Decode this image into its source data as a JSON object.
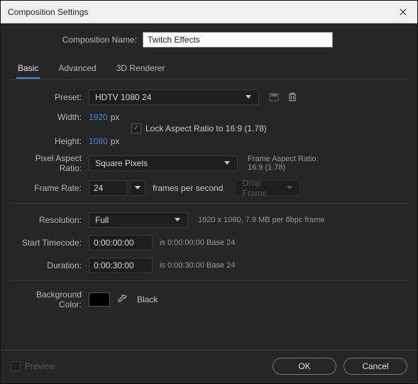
{
  "titlebar": {
    "title": "Composition Settings"
  },
  "comp_name": {
    "label": "Composition Name:",
    "value": "Twitch Effects"
  },
  "tabs": {
    "basic": "Basic",
    "advanced": "Advanced",
    "renderer": "3D Renderer"
  },
  "preset": {
    "label": "Preset:",
    "value": "HDTV 1080 24"
  },
  "width": {
    "label": "Width:",
    "value": "1920",
    "unit": "px"
  },
  "height": {
    "label": "Height:",
    "value": "1080",
    "unit": "px"
  },
  "lock_aspect": {
    "label": "Lock Aspect Ratio to 16:9 (1.78)"
  },
  "par": {
    "label": "Pixel Aspect Ratio:",
    "value": "Square Pixels"
  },
  "far": {
    "label": "Frame Aspect Ratio:",
    "value": "16:9 (1.78)"
  },
  "fps": {
    "label": "Frame Rate:",
    "value": "24",
    "suffix": "frames per second",
    "drop": "Drop Frame"
  },
  "resolution": {
    "label": "Resolution:",
    "value": "Full",
    "info": "1920 x 1080, 7.9 MB per 8bpc frame"
  },
  "start_tc": {
    "label": "Start Timecode:",
    "value": "0:00:00:00",
    "hint": "is 0:00:00:00  Base 24"
  },
  "duration": {
    "label": "Duration:",
    "value": "0:00:30:00",
    "hint": "is 0:00:30:00  Base 24"
  },
  "bg": {
    "label": "Background Color:",
    "name": "Black"
  },
  "footer": {
    "preview": "Preview",
    "ok": "OK",
    "cancel": "Cancel"
  }
}
